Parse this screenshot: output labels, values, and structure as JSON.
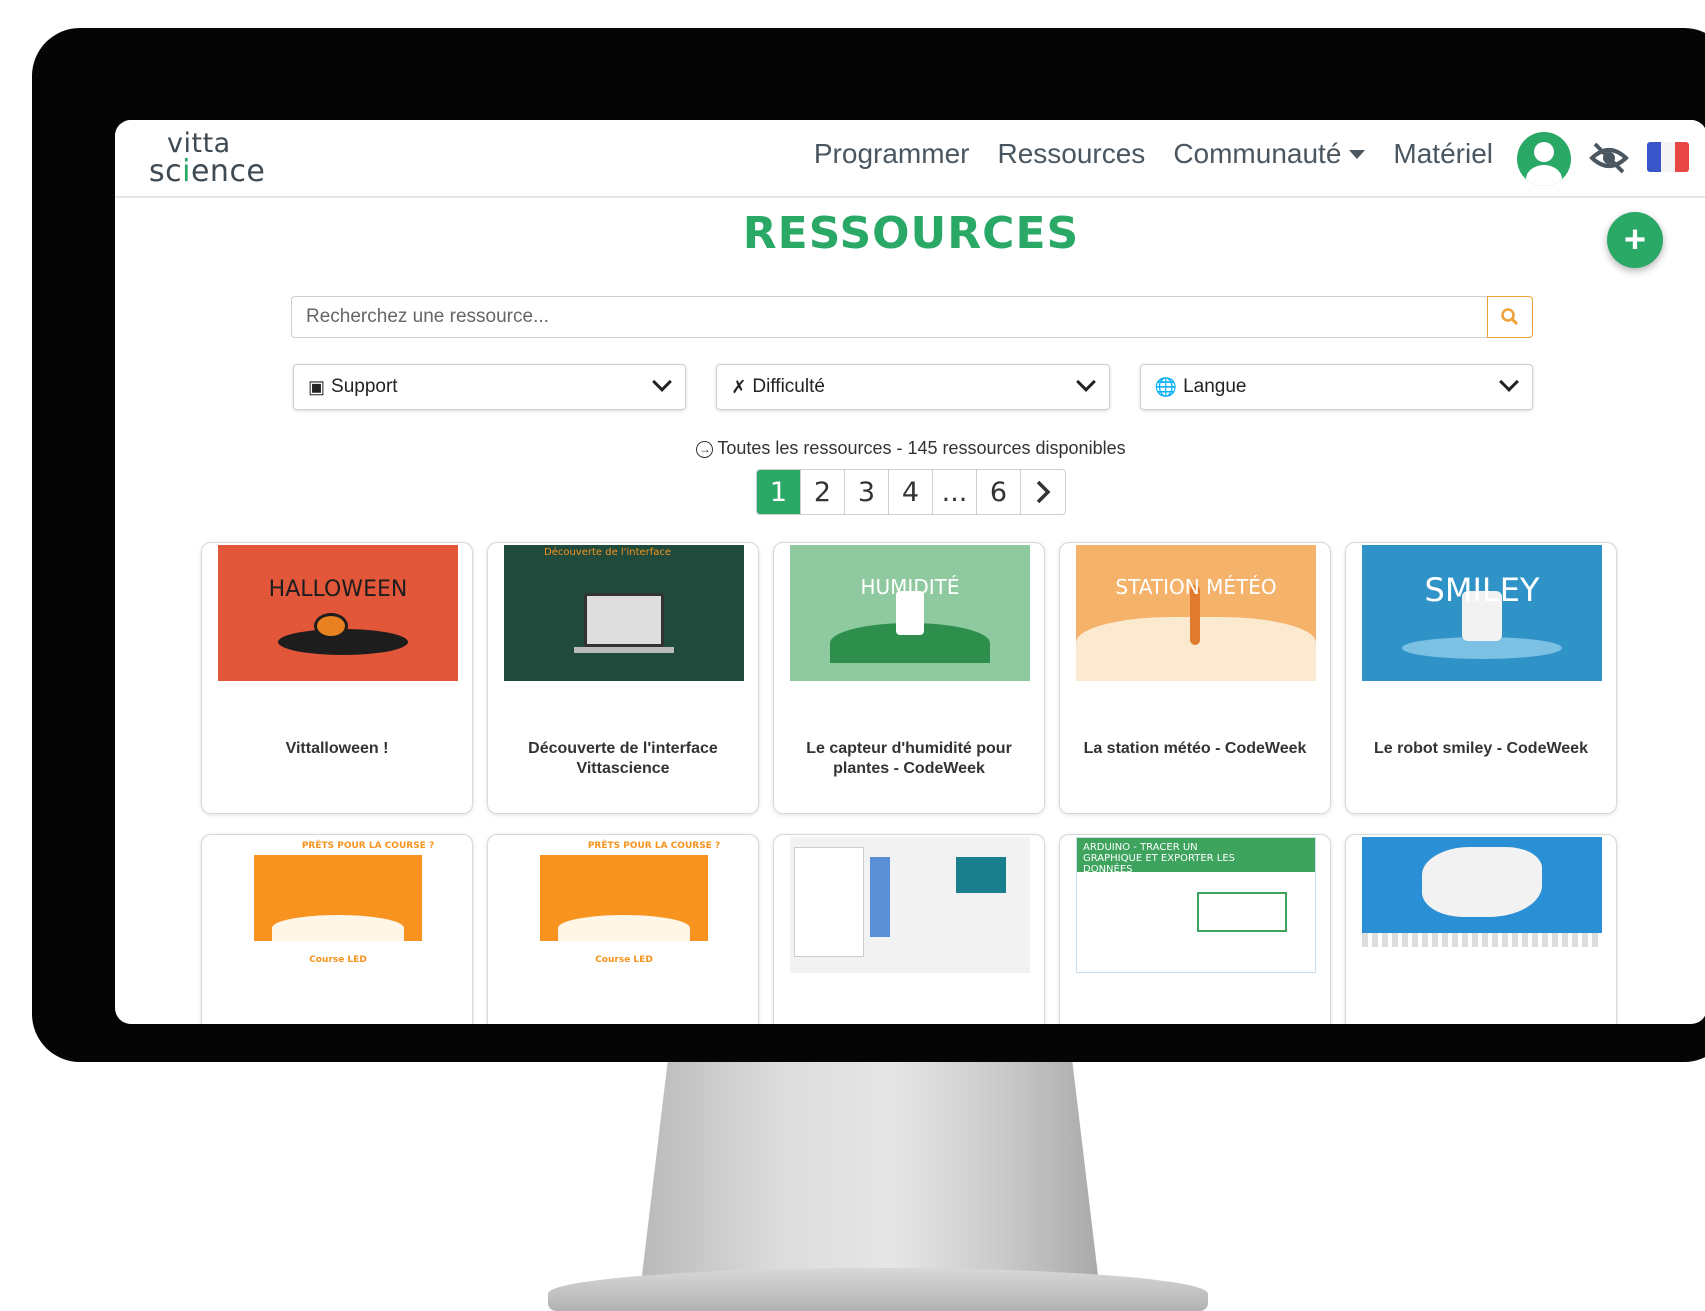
{
  "nav": {
    "logo_line1": "vitta",
    "logo_line2_a": "sc",
    "logo_line2_i": "i",
    "logo_line2_b": "ence",
    "links": [
      "Programmer",
      "Ressources",
      "Communauté",
      "Matériel"
    ]
  },
  "page": {
    "title": "RESSOURCES",
    "add_label": "+"
  },
  "search": {
    "placeholder": "Recherchez une ressource..."
  },
  "filters": [
    {
      "label": "Support",
      "icon": "box-icon"
    },
    {
      "label": "Difficulté",
      "icon": "tools-icon"
    },
    {
      "label": "Langue",
      "icon": "globe-icon"
    }
  ],
  "results": {
    "text": "Toutes les ressources - 145 ressources disponibles"
  },
  "pagination": [
    "1",
    "2",
    "3",
    "4",
    "...",
    "6"
  ],
  "cards": [
    {
      "title": "Vittalloween !",
      "thumb_text": "HALLOWEEN",
      "thumb_color": "#e2573a"
    },
    {
      "title": "Découverte de l'interface Vittascience",
      "thumb_text": "Découverte de l'interface",
      "thumb_color": "#1f4a3c"
    },
    {
      "title": "Le capteur d'humidité pour plantes - CodeWeek",
      "thumb_text": "HUMIDITÉ",
      "thumb_color": "#8fc9a0"
    },
    {
      "title": "La station météo - CodeWeek",
      "thumb_text": "STATION MÉTÉO",
      "thumb_color": "#f5b26b"
    },
    {
      "title": "Le robot smiley - CodeWeek",
      "thumb_text": "SMILEY",
      "thumb_color": "#2f93c8"
    },
    {
      "title": "",
      "thumb_text": "PRÊTS POUR LA COURSE ?",
      "thumb_sub": "Course LED",
      "thumb_color": "#f7931e"
    },
    {
      "title": "",
      "thumb_text": "PRÊTS POUR LA COURSE ?",
      "thumb_sub": "Course LED",
      "thumb_color": "#f7931e"
    },
    {
      "title": "",
      "thumb_text": "",
      "thumb_color": "#f2f2f2"
    },
    {
      "title": "",
      "thumb_text": "ARDUINO - TRACER UN GRAPHIQUE ET EXPORTER LES DONNÉES",
      "thumb_color": "#3da35d"
    },
    {
      "title": "",
      "thumb_text": "",
      "thumb_color": "#2b8fd6"
    }
  ],
  "colors": {
    "brand": "#2aa866",
    "search_accent": "#f0a23a"
  }
}
